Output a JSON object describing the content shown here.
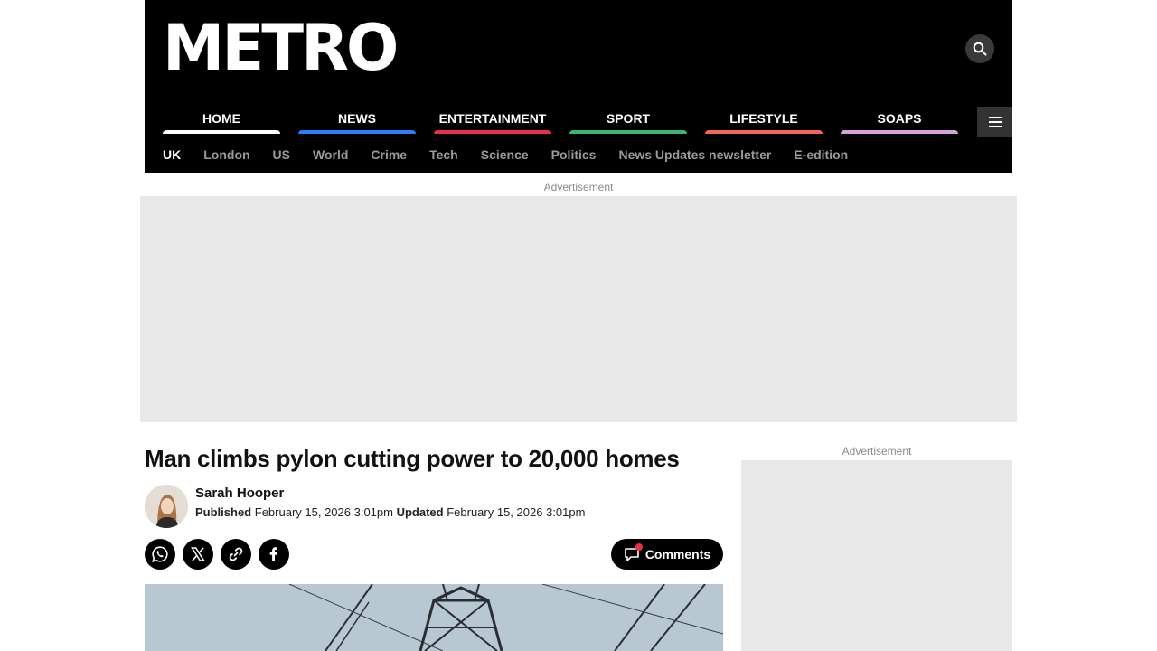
{
  "header": {
    "logo_text": "METRO",
    "search_icon": "search-icon",
    "menu_icon": "hamburger-icon"
  },
  "main_nav": [
    {
      "label": "HOME",
      "color": "#ffffff"
    },
    {
      "label": "NEWS",
      "color": "#2d7ff9"
    },
    {
      "label": "ENTERTAINMENT",
      "color": "#e7304a"
    },
    {
      "label": "SPORT",
      "color": "#3cb371"
    },
    {
      "label": "LIFESTYLE",
      "color": "#f0685a"
    },
    {
      "label": "SOAPS",
      "color": "#d7a1dc"
    }
  ],
  "sub_nav": [
    "UK",
    "London",
    "US",
    "World",
    "Crime",
    "Tech",
    "Science",
    "Politics",
    "News Updates newsletter",
    "E-edition"
  ],
  "ads": {
    "top_label": "Advertisement",
    "side_label": "Advertisement"
  },
  "article": {
    "headline": "Man climbs pylon cutting power to 20,000 homes",
    "author": "Sarah Hooper",
    "published_label": "Published",
    "published_date": "February 15, 2026 3:01pm",
    "updated_label": "Updated",
    "updated_date": "February 15, 2026 3:01pm",
    "comments_label": "Comments"
  },
  "share_icons": [
    "whatsapp-icon",
    "x-icon",
    "link-icon",
    "facebook-icon"
  ],
  "colors": {
    "masthead_bg": "#000000",
    "ad_bg": "#e8e8e8",
    "notification_dot": "#e7304a"
  }
}
